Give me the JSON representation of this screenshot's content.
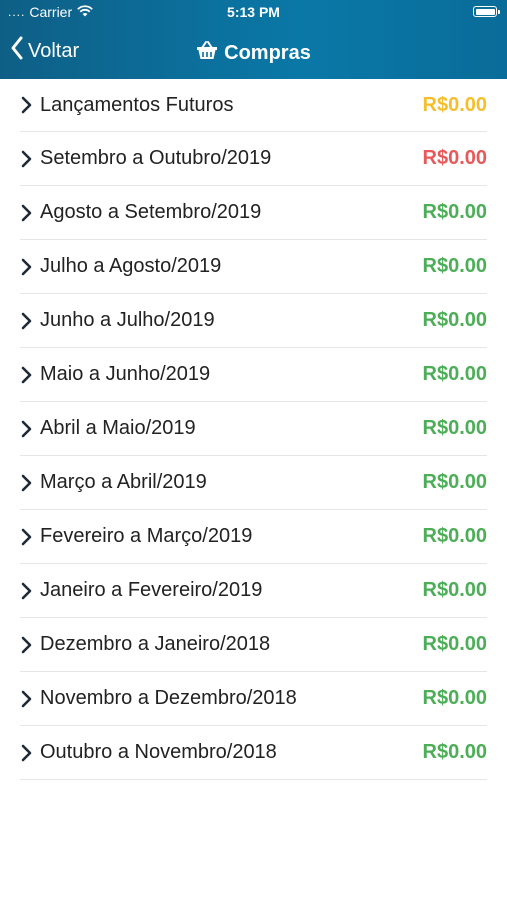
{
  "status_bar": {
    "carrier": "Carrier",
    "time": "5:13 PM",
    "dots": "....",
    "wifi_icon": "wifi-icon",
    "battery_icon": "battery-icon"
  },
  "nav": {
    "back_label": "Voltar",
    "title": "Compras",
    "title_icon": "basket-icon"
  },
  "colors": {
    "header_gradient_start": "#0e5f86",
    "header_gradient_end": "#0a78a7",
    "yellow": "#f5bf2c",
    "red": "#e85a5a",
    "green": "#4cae57",
    "chevron": "#1e2a3a"
  },
  "items": [
    {
      "label": "Lançamentos Futuros",
      "amount": "R$0.00",
      "status": "yellow"
    },
    {
      "label": "Setembro a Outubro/2019",
      "amount": "R$0.00",
      "status": "red"
    },
    {
      "label": "Agosto a Setembro/2019",
      "amount": "R$0.00",
      "status": "green"
    },
    {
      "label": "Julho a Agosto/2019",
      "amount": "R$0.00",
      "status": "green"
    },
    {
      "label": "Junho a Julho/2019",
      "amount": "R$0.00",
      "status": "green"
    },
    {
      "label": "Maio a Junho/2019",
      "amount": "R$0.00",
      "status": "green"
    },
    {
      "label": "Abril a Maio/2019",
      "amount": "R$0.00",
      "status": "green"
    },
    {
      "label": "Março a Abril/2019",
      "amount": "R$0.00",
      "status": "green"
    },
    {
      "label": "Fevereiro a Março/2019",
      "amount": "R$0.00",
      "status": "green"
    },
    {
      "label": "Janeiro a Fevereiro/2019",
      "amount": "R$0.00",
      "status": "green"
    },
    {
      "label": "Dezembro a Janeiro/2018",
      "amount": "R$0.00",
      "status": "green"
    },
    {
      "label": "Novembro a Dezembro/2018",
      "amount": "R$0.00",
      "status": "green"
    },
    {
      "label": "Outubro a Novembro/2018",
      "amount": "R$0.00",
      "status": "green"
    }
  ]
}
